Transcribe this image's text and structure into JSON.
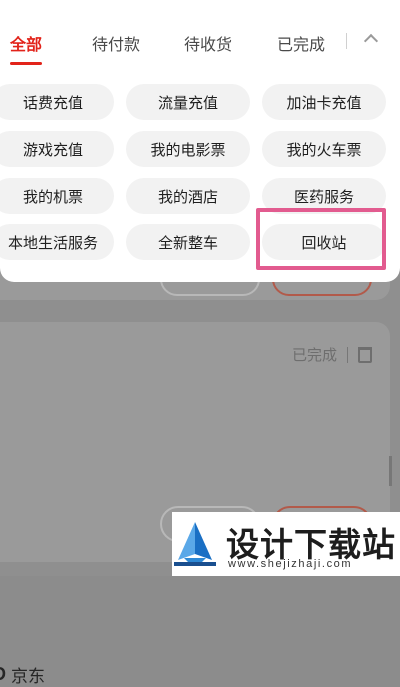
{
  "tabs": [
    {
      "label": "全部"
    },
    {
      "label": "待付款"
    },
    {
      "label": "待收货"
    },
    {
      "label": "已完成"
    }
  ],
  "categories": [
    {
      "label": "话费充值"
    },
    {
      "label": "流量充值"
    },
    {
      "label": "加油卡充值"
    },
    {
      "label": "游戏充值"
    },
    {
      "label": "我的电影票"
    },
    {
      "label": "我的火车票"
    },
    {
      "label": "我的机票"
    },
    {
      "label": "我的酒店"
    },
    {
      "label": "医药服务"
    },
    {
      "label": "本地生活服务"
    },
    {
      "label": "全新整车"
    },
    {
      "label": "回收站"
    }
  ],
  "order_card": {
    "store_logo": "JD",
    "store_name": "京东",
    "status": "已完成",
    "delete_icon": "trash-icon"
  },
  "watermark": {
    "title": "设计下载站",
    "url": "www.shejizhaji.com"
  },
  "colors": {
    "accent": "#e2231a",
    "highlight": "#e25b8f",
    "chip_bg": "#f2f2f2"
  }
}
